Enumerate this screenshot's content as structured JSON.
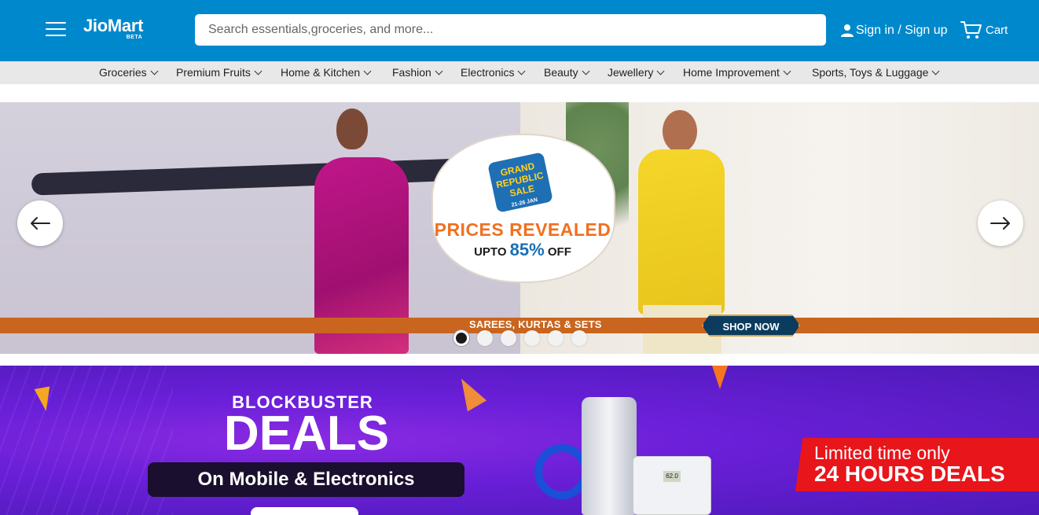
{
  "header": {
    "brand": "JioMart",
    "brand_tag": "BETA",
    "search_placeholder": "Search essentials,groceries, and more...",
    "signin_label": "Sign in / Sign up",
    "cart_label": "Cart",
    "colors": {
      "header_bg": "#0088cc",
      "nav_bg": "#e8e8e8"
    }
  },
  "categories": [
    "Groceries",
    "Premium Fruits",
    "Home & Kitchen",
    "Fashion",
    "Electronics",
    "Beauty",
    "Jewellery",
    "Home Improvement",
    "Sports, Toys & Luggage"
  ],
  "hero": {
    "badge_line1": "GRAND",
    "badge_line2": "REPUBLIC",
    "badge_line3": "SALE",
    "badge_dates": "21-26 JAN",
    "headline": "PRICES REVEALED",
    "upto_prefix": "UPTO",
    "upto_value": "85%",
    "upto_suffix": "OFF",
    "strip_text": "SAREES, KURTAS & SETS",
    "cta": "SHOP NOW",
    "slide_count": 6,
    "active_slide": 1,
    "icons": {
      "prev": "arrow-left-icon",
      "next": "arrow-right-icon"
    }
  },
  "deals": {
    "kicker": "BLOCKBUSTER",
    "title": "DEALS",
    "subtitle": "On Mobile & Electronics",
    "limited_line1": "Limited time only",
    "limited_line2": "24 HOURS DEALS",
    "scale_readout": "62.0",
    "colors": {
      "accent_red": "#e8151b",
      "bg_purple": "#6a1fd8"
    }
  }
}
